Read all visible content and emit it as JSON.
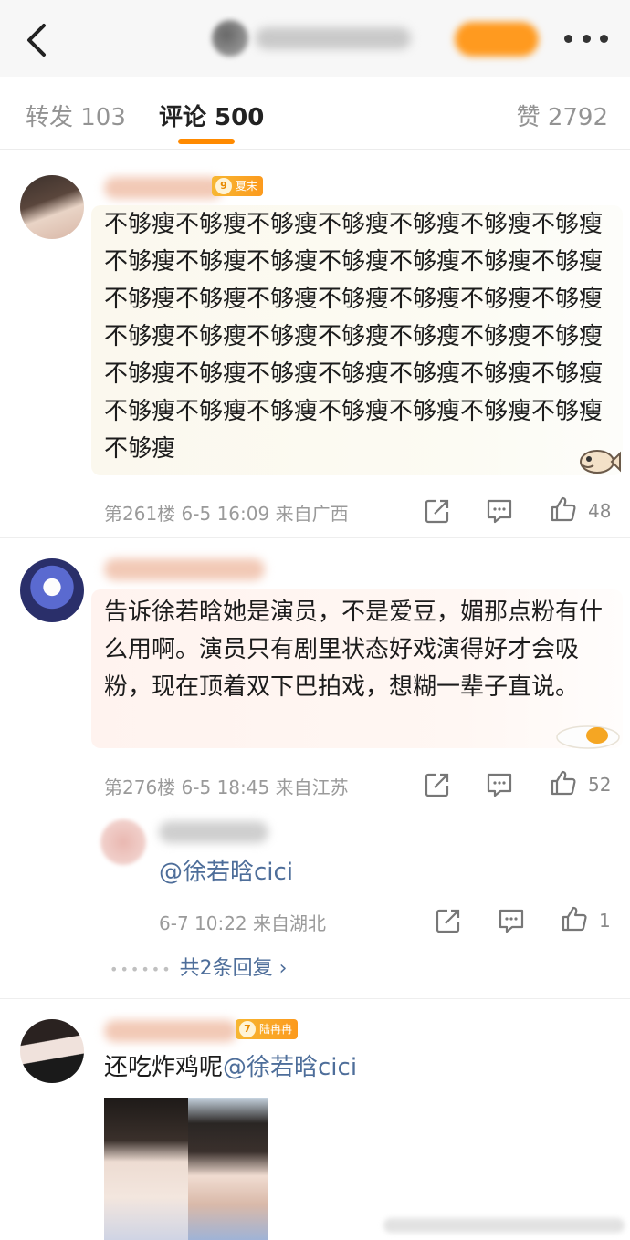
{
  "header": {
    "back_icon": "chevron-left-icon",
    "more_icon": "ellipsis-icon"
  },
  "tabs": {
    "repost": "转发 103",
    "comments": "评论 500",
    "likes": "赞 2792"
  },
  "comments": [
    {
      "badge_level": "9",
      "badge_text": "夏末",
      "text": "不够瘦不够瘦不够瘦不够瘦不够瘦不够瘦不够瘦不够瘦不够瘦不够瘦不够瘦不够瘦不够瘦不够瘦不够瘦不够瘦不够瘦不够瘦不够瘦不够瘦不够瘦不够瘦不够瘦不够瘦不够瘦不够瘦不够瘦不够瘦不够瘦不够瘦不够瘦不够瘦不够瘦不够瘦不够瘦不够瘦不够瘦不够瘦不够瘦不够瘦不够瘦不够瘦不够瘦",
      "floor": "第261楼",
      "time": "6-5 16:09",
      "location": "来自广西",
      "likes": "48"
    },
    {
      "text": "告诉徐若晗她是演员，不是爱豆，媚那点粉有什么用啊。演员只有剧里状态好戏演得好才会吸粉，现在顶着双下巴拍戏，想糊一辈子直说。",
      "floor": "第276楼",
      "time": "6-5 18:45",
      "location": "来自江苏",
      "likes": "52",
      "reply": {
        "mention": "@徐若晗cici",
        "time": "6-7 10:22",
        "location": "来自湖北",
        "likes": "1"
      },
      "more_replies": "共2条回复 ›"
    },
    {
      "badge_level": "7",
      "badge_text": "陆冉冉",
      "text_prefix": "还吃炸鸡呢",
      "mention": "@徐若晗cici"
    }
  ],
  "colors": {
    "accent": "#ff8a00",
    "link": "#4e6e9a",
    "meta": "#9a9a9a"
  }
}
